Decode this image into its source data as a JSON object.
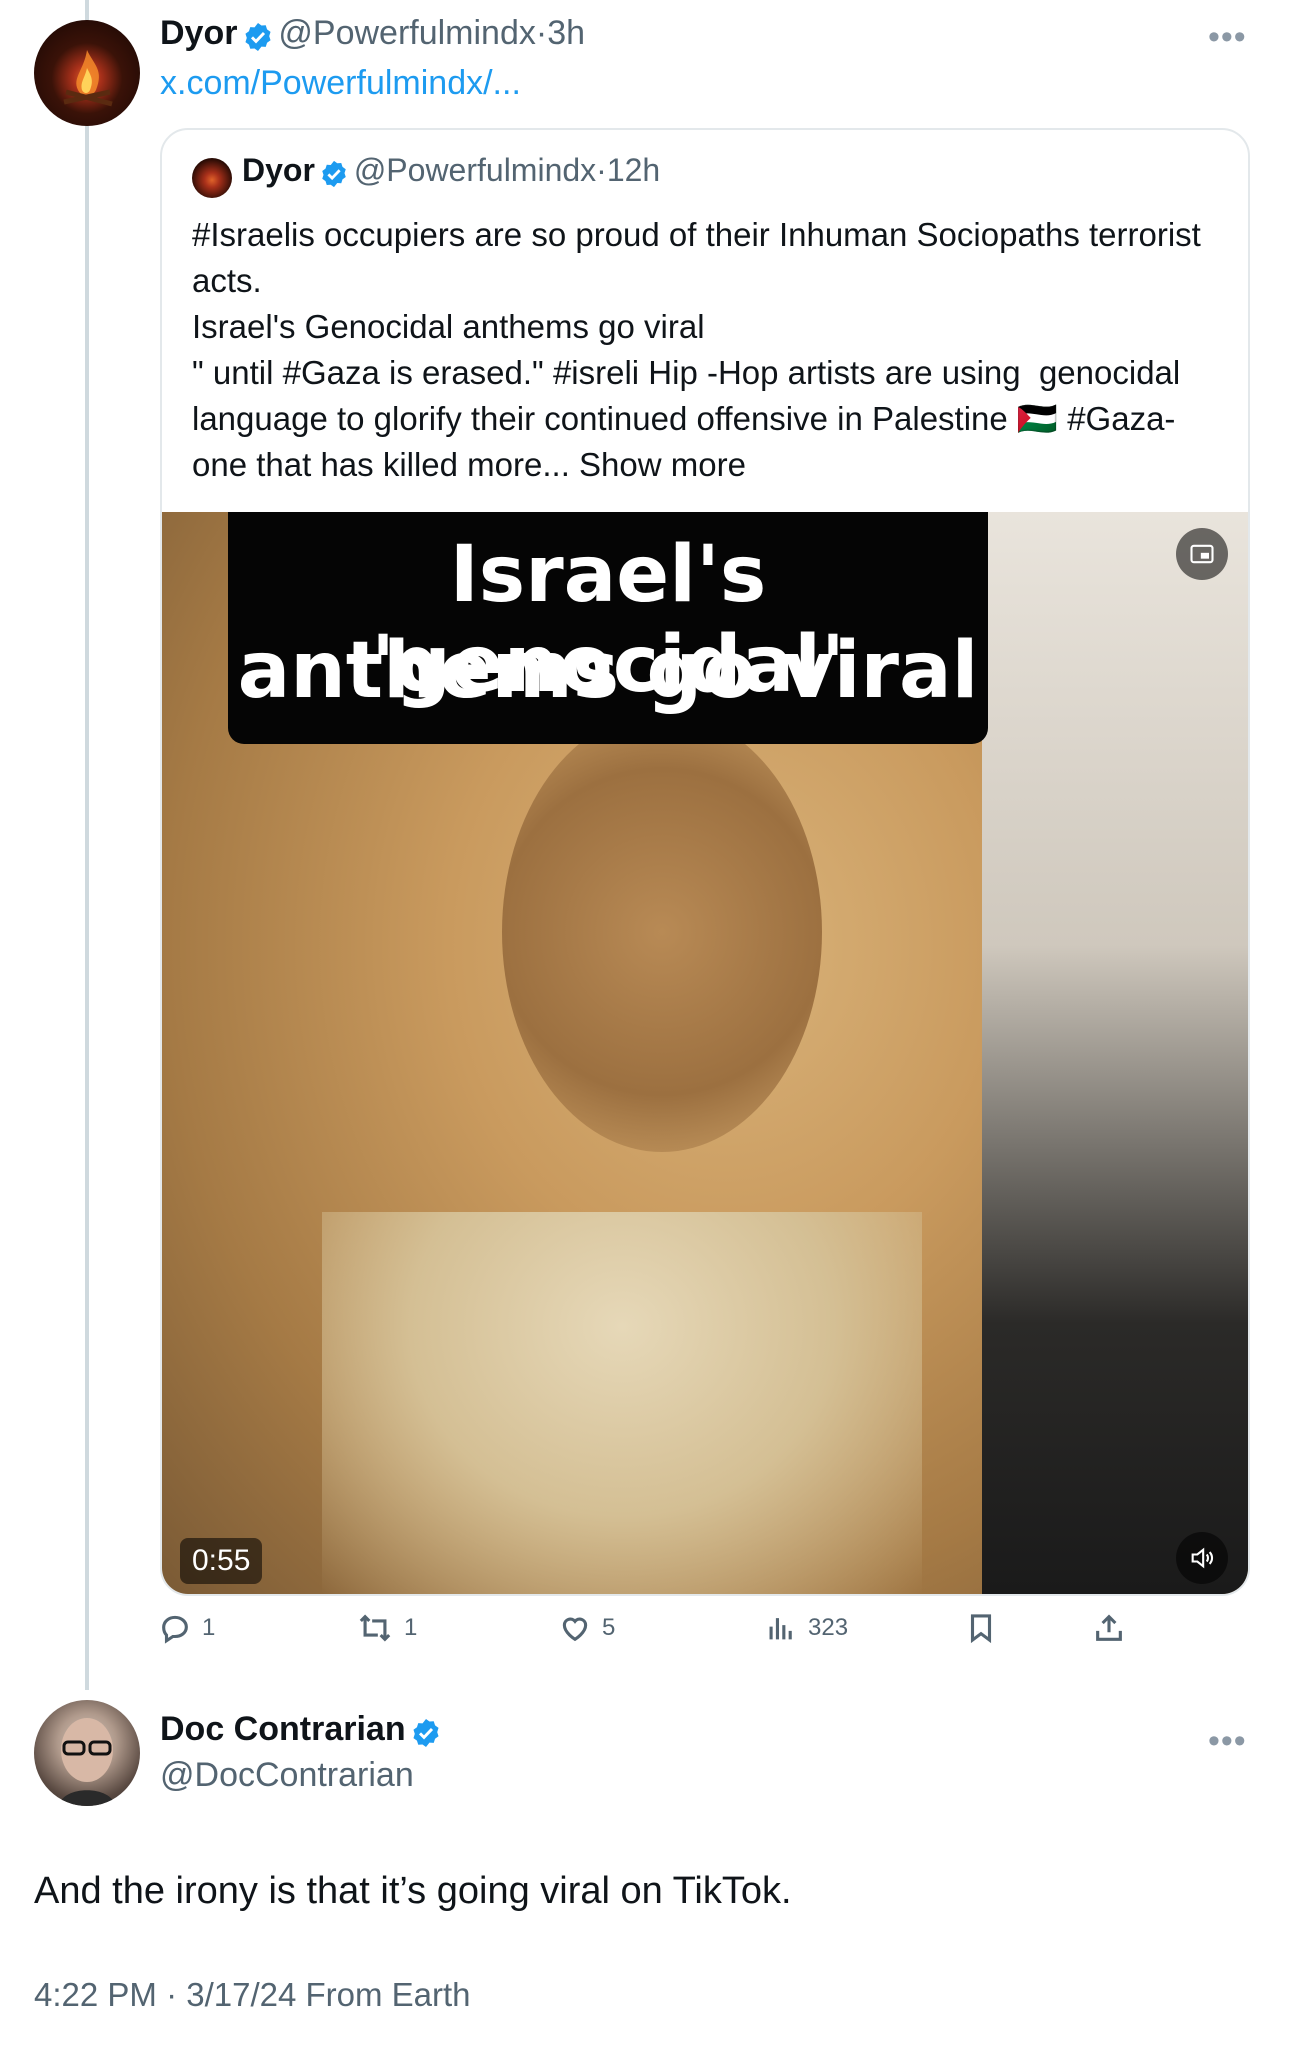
{
  "parent_tweet": {
    "name": "Dyor",
    "handle": "@Powerfulmindx",
    "separator": "·",
    "time": "3h",
    "link": "x.com/Powerfulmindx/..."
  },
  "quote": {
    "name": "Dyor",
    "handle": "@Powerfulmindx",
    "separator": "·",
    "time": "12h",
    "text": "#Israelis occupiers are so proud of their Inhuman Sociopaths terrorist acts.\nIsrael's Genocidal anthems go viral\n\" until #Gaza is erased.\" #isreli Hip -Hop artists are using  genocidal language to glorify their continued offensive in Palestine 🇵🇸 #Gaza- one that has killed more... Show more",
    "video": {
      "caption_line1": "Israel's 'genocidal'",
      "caption_line2": "anthems go viral",
      "duration": "0:55"
    }
  },
  "actions": {
    "replies": "1",
    "reposts": "1",
    "likes": "5",
    "views": "323"
  },
  "reply": {
    "name": "Doc Contrarian",
    "handle": "@DocContrarian",
    "text": "And the irony is that it’s going viral on TikTok.",
    "timestamp": "4:22 PM · 3/17/24 From Earth"
  },
  "colors": {
    "verified": "#1d9bf0",
    "link": "#1d9bf0",
    "secondary_text": "#536471"
  }
}
